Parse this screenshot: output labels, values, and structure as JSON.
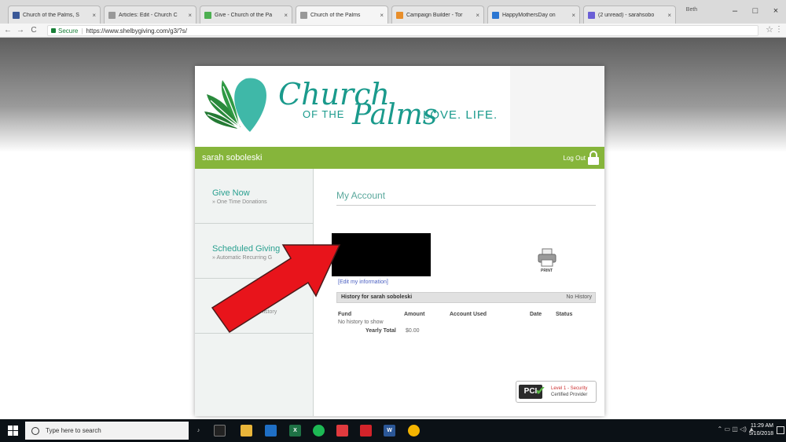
{
  "browser": {
    "tabs": [
      {
        "title": "Church of the Palms, S",
        "color": "#3b5998",
        "active": false
      },
      {
        "title": "Articles: Edit - Church C",
        "color": "#999999",
        "active": false
      },
      {
        "title": "Give - Church of the Pa",
        "color": "#4caf50",
        "active": false
      },
      {
        "title": "Church of the Palms",
        "color": "#999999",
        "active": true
      },
      {
        "title": "Campaign Builder - Tor",
        "color": "#e88e2a",
        "active": false
      },
      {
        "title": "HappyMothersDay on",
        "color": "#2a76d2",
        "active": false
      },
      {
        "title": "(2 unread) - sarahsobo",
        "color": "#6b5fd6",
        "active": false
      }
    ],
    "user_badge": "Beth",
    "secure_label": "Secure",
    "url": "https://www.shelbygiving.com/g3/?s/"
  },
  "page": {
    "logo": {
      "church": "Church",
      "of_the": "OF THE",
      "palms": "Palms",
      "tagline": "LOVE. LIFE."
    },
    "user_name": "sarah soboleski",
    "logout_label": "Log Out",
    "sidebar": [
      {
        "title": "Give Now",
        "subtitle": "» One Time Donations"
      },
      {
        "title": "Scheduled Giving",
        "subtitle": "» Automatic Recurring G"
      },
      {
        "title": "",
        "subtitle": "» & History"
      }
    ],
    "account": {
      "title": "My Account",
      "edit_link": "[Edit my information]",
      "print_label": "PRINT",
      "history_title": "History for sarah soboleski",
      "history_status": "No History",
      "columns": [
        "Fund",
        "Amount",
        "Account Used",
        "Date",
        "Status"
      ],
      "no_history": "No history to show",
      "yearly_total_label": "Yearly Total",
      "yearly_total_value": "$0.00"
    },
    "pci": {
      "logo": "PCI",
      "line1": "Level 1 - Security",
      "line2": "Certified Provider"
    }
  },
  "taskbar": {
    "search_placeholder": "Type here to search",
    "time": "11:29 AM",
    "date": "5/10/2018"
  }
}
